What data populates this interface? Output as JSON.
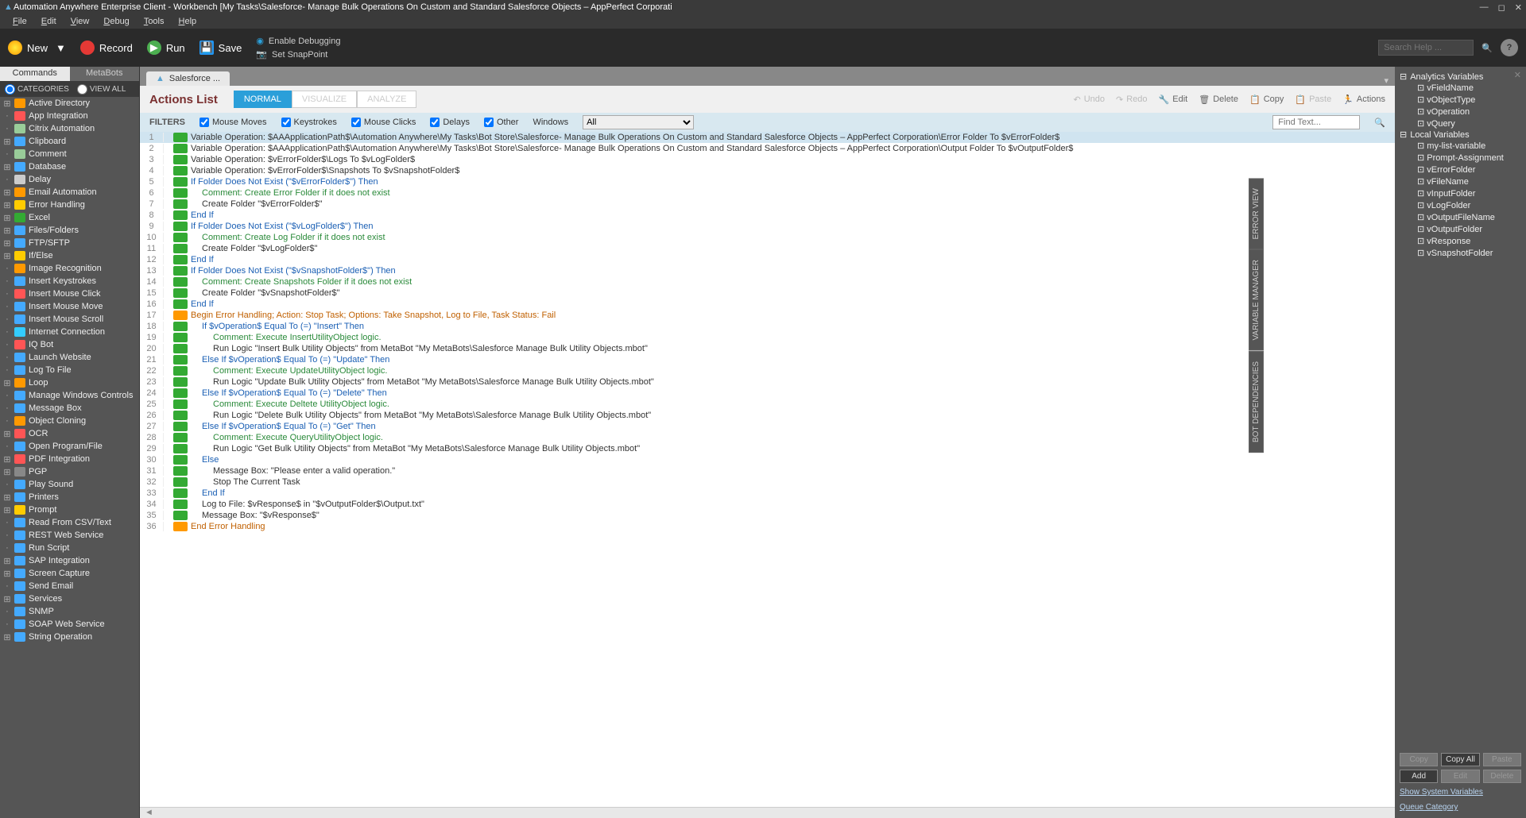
{
  "titlebar": {
    "text": "Automation Anywhere Enterprise Client - Workbench [My Tasks\\Salesforce- Manage Bulk Operations On Custom and Standard Salesforce Objects – AppPerfect Corporati"
  },
  "menubar": [
    "File",
    "Edit",
    "View",
    "Debug",
    "Tools",
    "Help"
  ],
  "toolbar": {
    "new": "New",
    "record": "Record",
    "run": "Run",
    "save": "Save",
    "enable_debugging": "Enable Debugging",
    "set_snappoint": "Set SnapPoint",
    "search_placeholder": "Search Help ..."
  },
  "sidebar": {
    "tabs": {
      "commands": "Commands",
      "metabots": "MetaBots"
    },
    "header": {
      "categories": "CATEGORIES",
      "viewall": "VIEW ALL"
    },
    "items": [
      {
        "exp": "+",
        "label": "Active Directory"
      },
      {
        "exp": "",
        "label": "App Integration"
      },
      {
        "exp": "",
        "label": "Citrix Automation"
      },
      {
        "exp": "+",
        "label": "Clipboard"
      },
      {
        "exp": "",
        "label": "Comment"
      },
      {
        "exp": "+",
        "label": "Database"
      },
      {
        "exp": "",
        "label": "Delay"
      },
      {
        "exp": "+",
        "label": "Email Automation"
      },
      {
        "exp": "+",
        "label": "Error Handling"
      },
      {
        "exp": "+",
        "label": "Excel"
      },
      {
        "exp": "+",
        "label": "Files/Folders"
      },
      {
        "exp": "+",
        "label": "FTP/SFTP"
      },
      {
        "exp": "+",
        "label": "If/Else"
      },
      {
        "exp": "",
        "label": "Image Recognition"
      },
      {
        "exp": "",
        "label": "Insert Keystrokes"
      },
      {
        "exp": "",
        "label": "Insert Mouse Click"
      },
      {
        "exp": "",
        "label": "Insert Mouse Move"
      },
      {
        "exp": "",
        "label": "Insert Mouse Scroll"
      },
      {
        "exp": "",
        "label": "Internet Connection"
      },
      {
        "exp": "",
        "label": "IQ Bot"
      },
      {
        "exp": "",
        "label": "Launch Website"
      },
      {
        "exp": "",
        "label": "Log To File"
      },
      {
        "exp": "+",
        "label": "Loop"
      },
      {
        "exp": "",
        "label": "Manage Windows Controls"
      },
      {
        "exp": "",
        "label": "Message Box"
      },
      {
        "exp": "",
        "label": "Object Cloning"
      },
      {
        "exp": "+",
        "label": "OCR"
      },
      {
        "exp": "",
        "label": "Open Program/File"
      },
      {
        "exp": "+",
        "label": "PDF Integration"
      },
      {
        "exp": "+",
        "label": "PGP"
      },
      {
        "exp": "",
        "label": "Play Sound"
      },
      {
        "exp": "+",
        "label": "Printers"
      },
      {
        "exp": "+",
        "label": "Prompt"
      },
      {
        "exp": "",
        "label": "Read From CSV/Text"
      },
      {
        "exp": "",
        "label": "REST Web Service"
      },
      {
        "exp": "",
        "label": "Run Script"
      },
      {
        "exp": "+",
        "label": "SAP Integration"
      },
      {
        "exp": "+",
        "label": "Screen Capture"
      },
      {
        "exp": "",
        "label": "Send Email"
      },
      {
        "exp": "+",
        "label": "Services"
      },
      {
        "exp": "",
        "label": "SNMP"
      },
      {
        "exp": "",
        "label": "SOAP Web Service"
      },
      {
        "exp": "+",
        "label": "String Operation"
      }
    ]
  },
  "content": {
    "tab": "Salesforce ...",
    "actions_title": "Actions List",
    "views": {
      "normal": "NORMAL",
      "visualize": "VISUALIZE",
      "analyze": "ANALYZE"
    },
    "buttons": {
      "undo": "Undo",
      "redo": "Redo",
      "edit": "Edit",
      "delete": "Delete",
      "copy": "Copy",
      "paste": "Paste",
      "actions": "Actions"
    },
    "filters": {
      "label": "FILTERS",
      "mouse_moves": "Mouse Moves",
      "keystrokes": "Keystrokes",
      "mouse_clicks": "Mouse Clicks",
      "delays": "Delays",
      "other": "Other",
      "windows": "Windows",
      "windows_value": "All",
      "find_placeholder": "Find Text..."
    },
    "lines": [
      {
        "n": 1,
        "cls": "",
        "indent": 0,
        "text": "Variable Operation: $AAApplicationPath$\\Automation Anywhere\\My Tasks\\Bot Store\\Salesforce- Manage Bulk Operations On Custom and Standard Salesforce Objects – AppPerfect Corporation\\Error Folder To $vErrorFolder$",
        "sel": true
      },
      {
        "n": 2,
        "cls": "",
        "indent": 0,
        "text": "Variable Operation: $AAApplicationPath$\\Automation Anywhere\\My Tasks\\Bot Store\\Salesforce- Manage Bulk Operations On Custom and Standard Salesforce Objects – AppPerfect Corporation\\Output Folder To $vOutputFolder$"
      },
      {
        "n": 3,
        "cls": "",
        "indent": 0,
        "text": "Variable Operation: $vErrorFolder$\\Logs To $vLogFolder$"
      },
      {
        "n": 4,
        "cls": "",
        "indent": 0,
        "text": "Variable Operation: $vErrorFolder$\\Snapshots To $vSnapshotFolder$"
      },
      {
        "n": 5,
        "cls": "blue",
        "indent": 0,
        "text": "If Folder Does Not Exist (\"$vErrorFolder$\")  Then"
      },
      {
        "n": 6,
        "cls": "green",
        "indent": 1,
        "text": "Comment: Create Error Folder if it does not exist"
      },
      {
        "n": 7,
        "cls": "",
        "indent": 1,
        "text": "Create Folder \"$vErrorFolder$\""
      },
      {
        "n": 8,
        "cls": "blue",
        "indent": 0,
        "text": "End If"
      },
      {
        "n": 9,
        "cls": "blue",
        "indent": 0,
        "text": "If Folder Does Not Exist (\"$vLogFolder$\")  Then"
      },
      {
        "n": 10,
        "cls": "green",
        "indent": 1,
        "text": "Comment: Create Log Folder if it does not exist"
      },
      {
        "n": 11,
        "cls": "",
        "indent": 1,
        "text": "Create Folder \"$vLogFolder$\""
      },
      {
        "n": 12,
        "cls": "blue",
        "indent": 0,
        "text": "End If"
      },
      {
        "n": 13,
        "cls": "blue",
        "indent": 0,
        "text": "If Folder Does Not Exist (\"$vSnapshotFolder$\")  Then"
      },
      {
        "n": 14,
        "cls": "green",
        "indent": 1,
        "text": "Comment: Create Snapshots Folder if it does not exist"
      },
      {
        "n": 15,
        "cls": "",
        "indent": 1,
        "text": "Create Folder \"$vSnapshotFolder$\""
      },
      {
        "n": 16,
        "cls": "blue",
        "indent": 0,
        "text": "End If"
      },
      {
        "n": 17,
        "cls": "orange",
        "indent": 0,
        "text": "Begin Error Handling; Action: Stop Task; Options: Take Snapshot, Log to File,  Task Status: Fail"
      },
      {
        "n": 18,
        "cls": "blue",
        "indent": 1,
        "text": "If $vOperation$ Equal To (=) \"Insert\" Then"
      },
      {
        "n": 19,
        "cls": "green",
        "indent": 2,
        "text": "Comment: Execute InsertUtilityObject logic."
      },
      {
        "n": 20,
        "cls": "",
        "indent": 2,
        "text": "Run Logic \"Insert Bulk Utility Objects\" from MetaBot \"My MetaBots\\Salesforce Manage Bulk Utility Objects.mbot\""
      },
      {
        "n": 21,
        "cls": "blue",
        "indent": 1,
        "text": "Else If $vOperation$ Equal To (=) \"Update\" Then"
      },
      {
        "n": 22,
        "cls": "green",
        "indent": 2,
        "text": "Comment: Execute UpdateUtilityObject logic."
      },
      {
        "n": 23,
        "cls": "",
        "indent": 2,
        "text": "Run Logic \"Update Bulk Utility Objects\" from MetaBot \"My MetaBots\\Salesforce Manage Bulk Utility Objects.mbot\""
      },
      {
        "n": 24,
        "cls": "blue",
        "indent": 1,
        "text": "Else If $vOperation$ Equal To (=) \"Delete\" Then"
      },
      {
        "n": 25,
        "cls": "green",
        "indent": 2,
        "text": "Comment: Execute Deltete UtilityObject logic."
      },
      {
        "n": 26,
        "cls": "",
        "indent": 2,
        "text": "Run Logic \"Delete Bulk Utility Objects\" from MetaBot \"My MetaBots\\Salesforce Manage Bulk Utility Objects.mbot\""
      },
      {
        "n": 27,
        "cls": "blue",
        "indent": 1,
        "text": "Else If $vOperation$ Equal To (=) \"Get\" Then"
      },
      {
        "n": 28,
        "cls": "green",
        "indent": 2,
        "text": "Comment: Execute QueryUtilityObject logic."
      },
      {
        "n": 29,
        "cls": "",
        "indent": 2,
        "text": "Run Logic \"Get Bulk Utility Objects\" from MetaBot \"My MetaBots\\Salesforce Manage Bulk Utility Objects.mbot\""
      },
      {
        "n": 30,
        "cls": "blue",
        "indent": 1,
        "text": "Else"
      },
      {
        "n": 31,
        "cls": "",
        "indent": 2,
        "text": "Message Box: \"Please enter a valid operation.\""
      },
      {
        "n": 32,
        "cls": "",
        "indent": 2,
        "text": "Stop The Current Task"
      },
      {
        "n": 33,
        "cls": "blue",
        "indent": 1,
        "text": "End If"
      },
      {
        "n": 34,
        "cls": "",
        "indent": 1,
        "text": "Log to File: $vResponse$ in \"$vOutputFolder$\\Output.txt\""
      },
      {
        "n": 35,
        "cls": "",
        "indent": 1,
        "text": "Message Box: \"$vResponse$\""
      },
      {
        "n": 36,
        "cls": "orange",
        "indent": 0,
        "text": "End Error Handling"
      }
    ]
  },
  "right_panel": {
    "analytics_header": "Analytics Variables",
    "analytics": [
      "vFieldName",
      "vObjectType",
      "vOperation",
      "vQuery"
    ],
    "local_header": "Local Variables",
    "local": [
      "my-list-variable",
      "Prompt-Assignment",
      "vErrorFolder",
      "vFileName",
      "vInputFolder",
      "vLogFolder",
      "vOutputFileName",
      "vOutputFolder",
      "vResponse",
      "vSnapshotFolder"
    ],
    "buttons": {
      "copy": "Copy",
      "copy_all": "Copy All",
      "paste": "Paste",
      "add": "Add",
      "edit": "Edit",
      "delete": "Delete"
    },
    "links": {
      "show_sys": "Show System Variables",
      "queue": "Queue Category"
    }
  },
  "side_tabs": [
    "ERROR VIEW",
    "VARIABLE MANAGER",
    "BOT DEPENDENCIES"
  ]
}
